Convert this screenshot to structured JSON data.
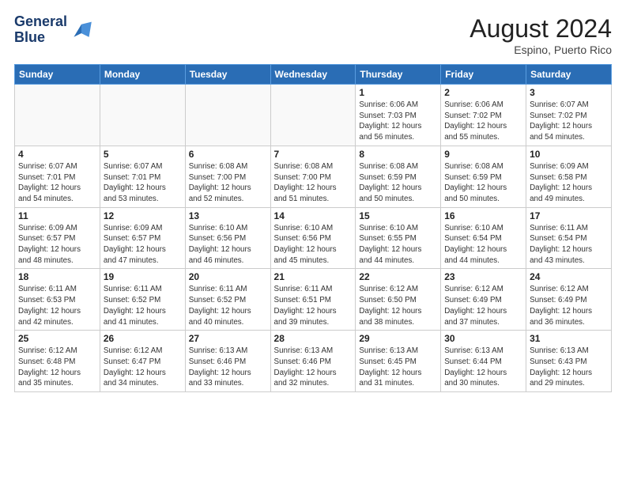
{
  "header": {
    "logo_line1": "General",
    "logo_line2": "Blue",
    "month_year": "August 2024",
    "location": "Espino, Puerto Rico"
  },
  "weekdays": [
    "Sunday",
    "Monday",
    "Tuesday",
    "Wednesday",
    "Thursday",
    "Friday",
    "Saturday"
  ],
  "weeks": [
    [
      {
        "day": "",
        "info": ""
      },
      {
        "day": "",
        "info": ""
      },
      {
        "day": "",
        "info": ""
      },
      {
        "day": "",
        "info": ""
      },
      {
        "day": "1",
        "info": "Sunrise: 6:06 AM\nSunset: 7:03 PM\nDaylight: 12 hours\nand 56 minutes."
      },
      {
        "day": "2",
        "info": "Sunrise: 6:06 AM\nSunset: 7:02 PM\nDaylight: 12 hours\nand 55 minutes."
      },
      {
        "day": "3",
        "info": "Sunrise: 6:07 AM\nSunset: 7:02 PM\nDaylight: 12 hours\nand 54 minutes."
      }
    ],
    [
      {
        "day": "4",
        "info": "Sunrise: 6:07 AM\nSunset: 7:01 PM\nDaylight: 12 hours\nand 54 minutes."
      },
      {
        "day": "5",
        "info": "Sunrise: 6:07 AM\nSunset: 7:01 PM\nDaylight: 12 hours\nand 53 minutes."
      },
      {
        "day": "6",
        "info": "Sunrise: 6:08 AM\nSunset: 7:00 PM\nDaylight: 12 hours\nand 52 minutes."
      },
      {
        "day": "7",
        "info": "Sunrise: 6:08 AM\nSunset: 7:00 PM\nDaylight: 12 hours\nand 51 minutes."
      },
      {
        "day": "8",
        "info": "Sunrise: 6:08 AM\nSunset: 6:59 PM\nDaylight: 12 hours\nand 50 minutes."
      },
      {
        "day": "9",
        "info": "Sunrise: 6:08 AM\nSunset: 6:59 PM\nDaylight: 12 hours\nand 50 minutes."
      },
      {
        "day": "10",
        "info": "Sunrise: 6:09 AM\nSunset: 6:58 PM\nDaylight: 12 hours\nand 49 minutes."
      }
    ],
    [
      {
        "day": "11",
        "info": "Sunrise: 6:09 AM\nSunset: 6:57 PM\nDaylight: 12 hours\nand 48 minutes."
      },
      {
        "day": "12",
        "info": "Sunrise: 6:09 AM\nSunset: 6:57 PM\nDaylight: 12 hours\nand 47 minutes."
      },
      {
        "day": "13",
        "info": "Sunrise: 6:10 AM\nSunset: 6:56 PM\nDaylight: 12 hours\nand 46 minutes."
      },
      {
        "day": "14",
        "info": "Sunrise: 6:10 AM\nSunset: 6:56 PM\nDaylight: 12 hours\nand 45 minutes."
      },
      {
        "day": "15",
        "info": "Sunrise: 6:10 AM\nSunset: 6:55 PM\nDaylight: 12 hours\nand 44 minutes."
      },
      {
        "day": "16",
        "info": "Sunrise: 6:10 AM\nSunset: 6:54 PM\nDaylight: 12 hours\nand 44 minutes."
      },
      {
        "day": "17",
        "info": "Sunrise: 6:11 AM\nSunset: 6:54 PM\nDaylight: 12 hours\nand 43 minutes."
      }
    ],
    [
      {
        "day": "18",
        "info": "Sunrise: 6:11 AM\nSunset: 6:53 PM\nDaylight: 12 hours\nand 42 minutes."
      },
      {
        "day": "19",
        "info": "Sunrise: 6:11 AM\nSunset: 6:52 PM\nDaylight: 12 hours\nand 41 minutes."
      },
      {
        "day": "20",
        "info": "Sunrise: 6:11 AM\nSunset: 6:52 PM\nDaylight: 12 hours\nand 40 minutes."
      },
      {
        "day": "21",
        "info": "Sunrise: 6:11 AM\nSunset: 6:51 PM\nDaylight: 12 hours\nand 39 minutes."
      },
      {
        "day": "22",
        "info": "Sunrise: 6:12 AM\nSunset: 6:50 PM\nDaylight: 12 hours\nand 38 minutes."
      },
      {
        "day": "23",
        "info": "Sunrise: 6:12 AM\nSunset: 6:49 PM\nDaylight: 12 hours\nand 37 minutes."
      },
      {
        "day": "24",
        "info": "Sunrise: 6:12 AM\nSunset: 6:49 PM\nDaylight: 12 hours\nand 36 minutes."
      }
    ],
    [
      {
        "day": "25",
        "info": "Sunrise: 6:12 AM\nSunset: 6:48 PM\nDaylight: 12 hours\nand 35 minutes."
      },
      {
        "day": "26",
        "info": "Sunrise: 6:12 AM\nSunset: 6:47 PM\nDaylight: 12 hours\nand 34 minutes."
      },
      {
        "day": "27",
        "info": "Sunrise: 6:13 AM\nSunset: 6:46 PM\nDaylight: 12 hours\nand 33 minutes."
      },
      {
        "day": "28",
        "info": "Sunrise: 6:13 AM\nSunset: 6:46 PM\nDaylight: 12 hours\nand 32 minutes."
      },
      {
        "day": "29",
        "info": "Sunrise: 6:13 AM\nSunset: 6:45 PM\nDaylight: 12 hours\nand 31 minutes."
      },
      {
        "day": "30",
        "info": "Sunrise: 6:13 AM\nSunset: 6:44 PM\nDaylight: 12 hours\nand 30 minutes."
      },
      {
        "day": "31",
        "info": "Sunrise: 6:13 AM\nSunset: 6:43 PM\nDaylight: 12 hours\nand 29 minutes."
      }
    ]
  ]
}
